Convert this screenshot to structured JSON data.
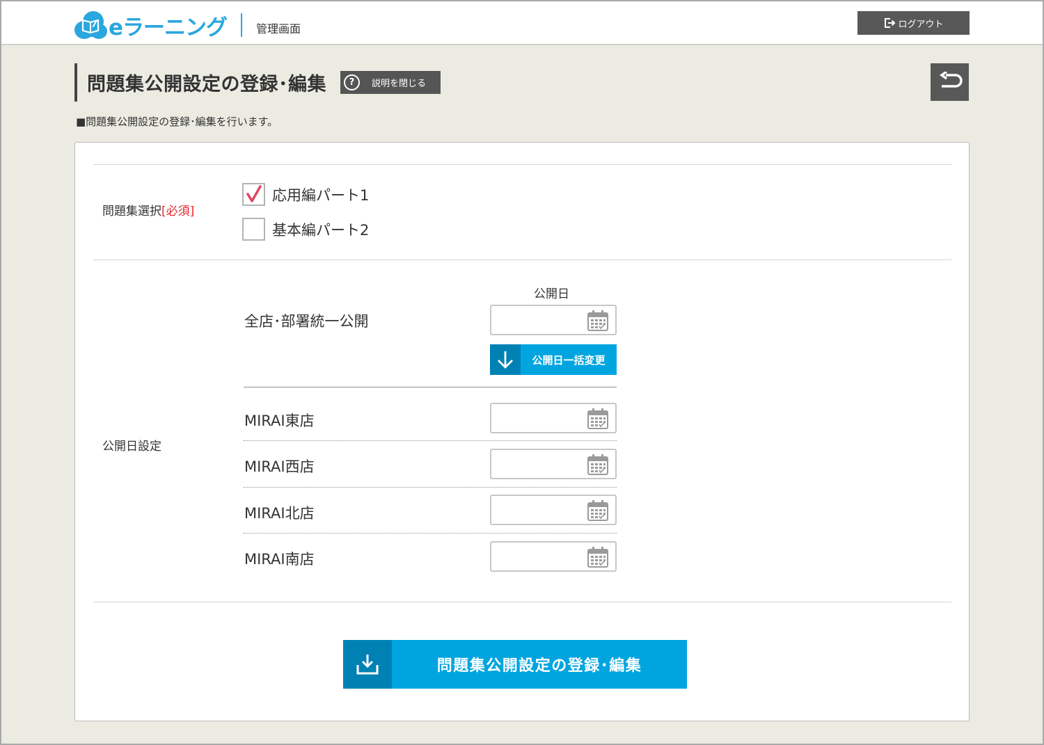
{
  "header": {
    "logo_text": "eラーニング",
    "subtitle": "管理画面",
    "logout_label": "ログアウト"
  },
  "page": {
    "title": "問題集公開設定の登録･編集",
    "help_label": "説明を閉じる",
    "help_icon": "?",
    "description": "■問題集公開設定の登録･編集を行います。"
  },
  "form": {
    "workbook_label": "問題集選択",
    "required_mark": "[必須]",
    "workbooks": [
      {
        "label": "応用編パート1",
        "checked": true
      },
      {
        "label": "基本編パート2",
        "checked": false
      }
    ],
    "date_setting_label": "公開日設定",
    "date_column_header": "公開日",
    "all_stores_label": "全店･部署統一公開",
    "all_stores_date": "",
    "bulk_change_label": "公開日一括変更",
    "stores": [
      {
        "name": "MIRAI東店",
        "date": ""
      },
      {
        "name": "MIRAI西店",
        "date": ""
      },
      {
        "name": "MIRAI北店",
        "date": ""
      },
      {
        "name": "MIRAI南店",
        "date": ""
      }
    ],
    "submit_label": "問題集公開設定の登録･編集"
  },
  "colors": {
    "brand": "#29a7de",
    "primary_button": "#00a5e0",
    "primary_button_dark": "#0081b3",
    "check_mark": "#e0465e",
    "required": "#e8262d",
    "dark_button": "#585858"
  }
}
